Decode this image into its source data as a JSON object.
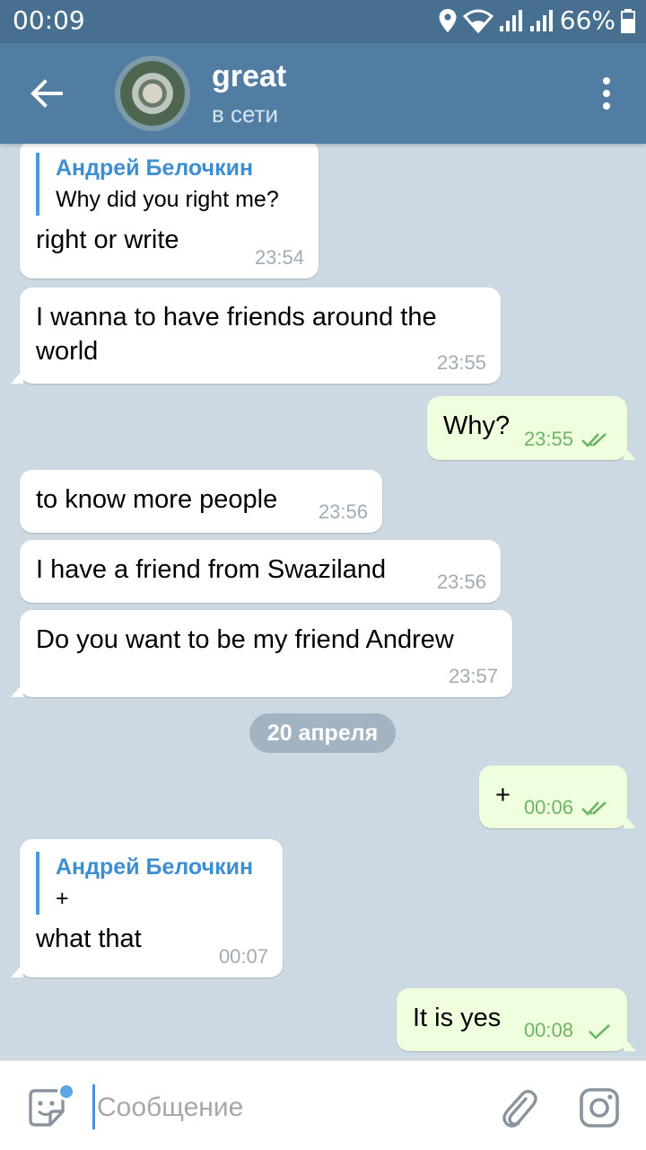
{
  "status_bar": {
    "time": "00:09",
    "battery": "66%"
  },
  "header": {
    "title": "great",
    "status": "в сети"
  },
  "messages": [
    {
      "dir": "in",
      "reply_author": "Андрей Белочкин",
      "reply_text": "Why did you right me?",
      "text": "right or write",
      "time": "23:54"
    },
    {
      "dir": "in",
      "text_line1": "I wanna to have friends around the",
      "text_line2": "world",
      "time": "23:55"
    },
    {
      "dir": "out",
      "text": "Why?",
      "time": "23:55",
      "status": "read"
    },
    {
      "dir": "in",
      "text": "to know more people",
      "time": "23:56"
    },
    {
      "dir": "in",
      "text": "I have a friend from Swaziland",
      "time": "23:56"
    },
    {
      "dir": "in",
      "text": "Do you want to be my friend Andrew",
      "time": "23:57"
    },
    {
      "dir": "out",
      "text": "+",
      "time": "00:06",
      "status": "read"
    },
    {
      "dir": "in",
      "reply_author": "Андрей Белочкин",
      "reply_text": "+",
      "text": "what that",
      "time": "00:07"
    },
    {
      "dir": "out",
      "text": "It is yes",
      "time": "00:08",
      "status": "sent"
    }
  ],
  "date_separator": "20 апреля",
  "input": {
    "placeholder": "Сообщение",
    "value": ""
  },
  "colors": {
    "header": "#527da3",
    "status_bar": "#466f90",
    "background": "#ccd9e3",
    "outgoing": "#efffde",
    "incoming": "#ffffff",
    "accent": "#3e8fd1",
    "out_time": "#6db566"
  },
  "icons": [
    "back-arrow-icon",
    "more-vertical-icon",
    "sticker-icon",
    "attach-icon",
    "camera-icon",
    "location-icon",
    "wifi-icon",
    "signal-icon",
    "battery-icon",
    "double-check-icon",
    "single-check-icon"
  ]
}
